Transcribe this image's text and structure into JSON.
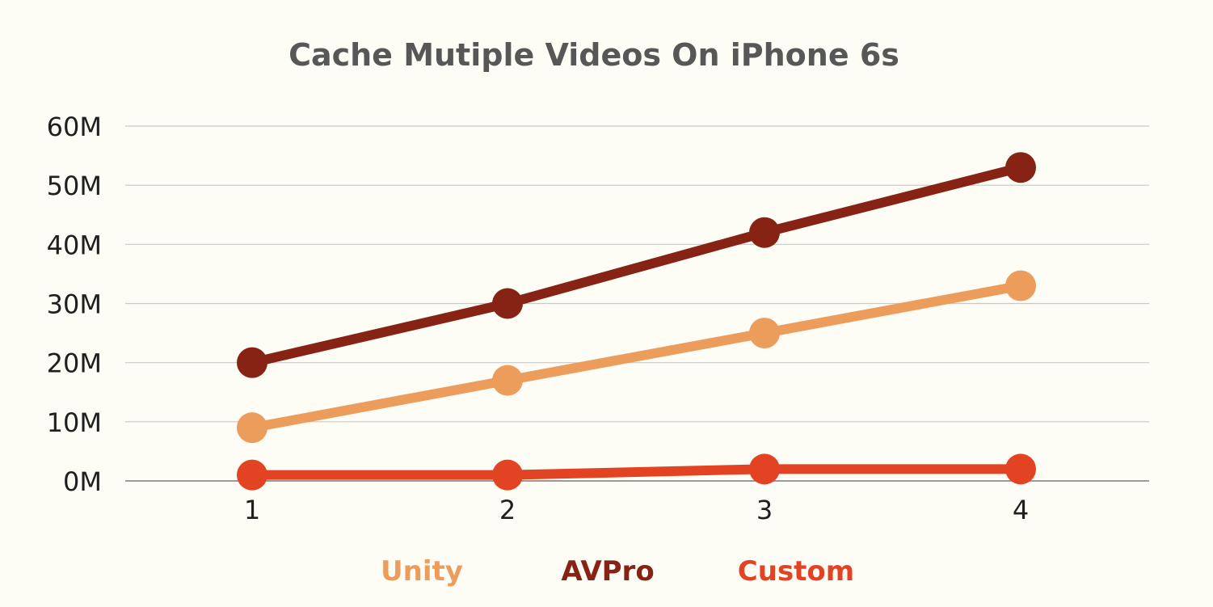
{
  "chart_data": {
    "type": "line",
    "title": "Cache Mutiple Videos On iPhone 6s",
    "xlabel": "",
    "ylabel": "",
    "x": [
      "1",
      "2",
      "3",
      "4"
    ],
    "y_ticks": [
      "0M",
      "10M",
      "20M",
      "30M",
      "40M",
      "50M",
      "60M"
    ],
    "ylim": [
      0,
      60
    ],
    "grid": true,
    "legend_position": "bottom",
    "series": [
      {
        "name": "Unity",
        "color": "#ec9d5c",
        "values": [
          9,
          17,
          25,
          33
        ]
      },
      {
        "name": "AVPro",
        "color": "#862314",
        "values": [
          20,
          30,
          42,
          53
        ]
      },
      {
        "name": "Custom",
        "color": "#e24423",
        "values": [
          1,
          1,
          2,
          2
        ]
      }
    ]
  }
}
